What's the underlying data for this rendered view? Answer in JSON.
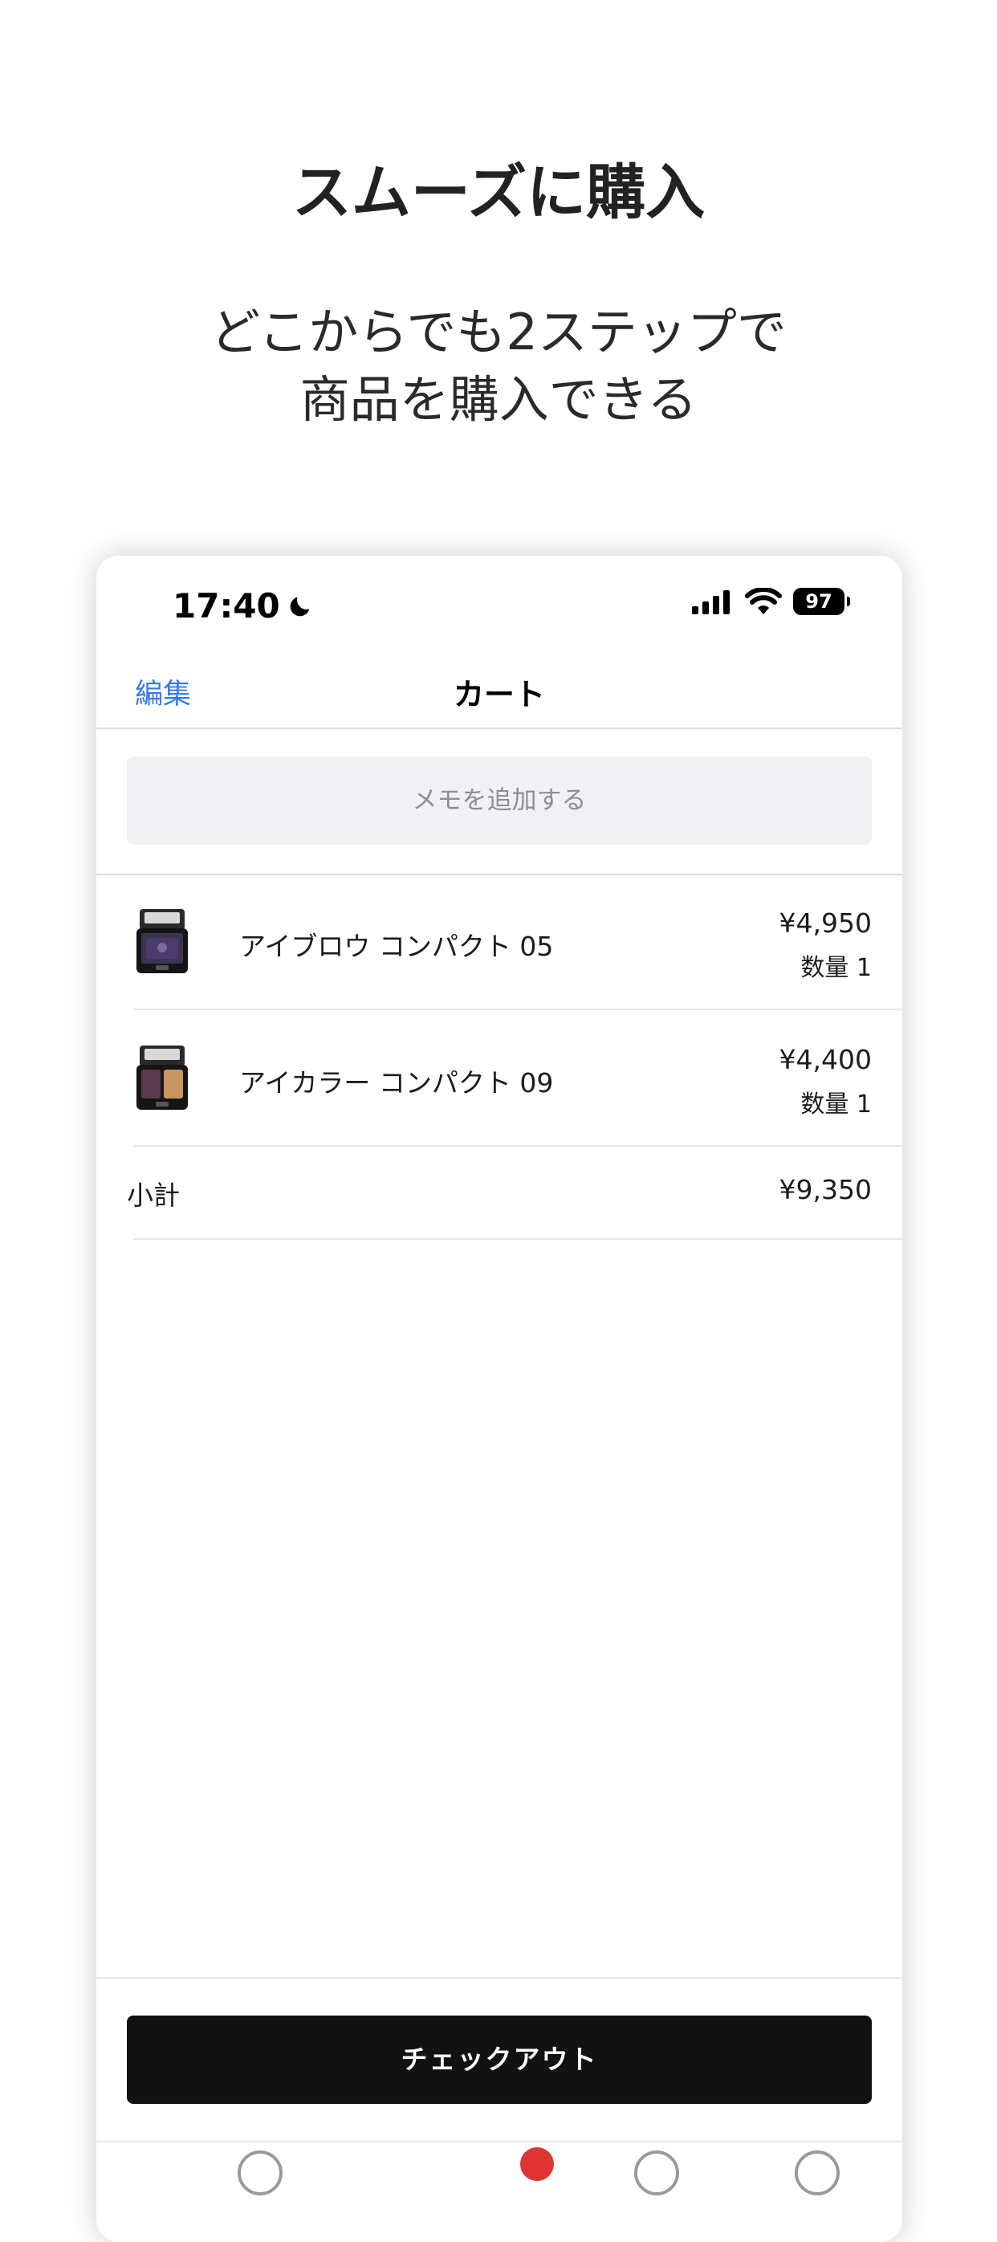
{
  "promo": {
    "title": "スムーズに購入",
    "subtitle_line1": "どこからでも2ステップで",
    "subtitle_line2": "商品を購入できる"
  },
  "status_bar": {
    "time": "17:40",
    "battery": "97",
    "icons": [
      "moon-icon",
      "cellular-signal-icon",
      "wifi-icon",
      "battery-icon"
    ]
  },
  "nav": {
    "edit_label": "編集",
    "title": "カート"
  },
  "memo": {
    "placeholder": "メモを追加する"
  },
  "cart": {
    "items": [
      {
        "name": "アイブロウ コンパクト 05",
        "price": "¥4,950",
        "quantity": "数量 1",
        "accent_color": "#4a3a6e"
      },
      {
        "name": "アイカラー コンパクト 09",
        "price": "¥4,400",
        "quantity": "数量 1",
        "accent_color": "#c9945f"
      }
    ],
    "subtotal_label": "小計",
    "subtotal_value": "¥9,350"
  },
  "checkout": {
    "label": "チェックアウト"
  },
  "colors": {
    "link": "#3478f6",
    "button_bg": "#121212",
    "memo_bg": "#f1f1f4",
    "badge": "#e03434"
  }
}
